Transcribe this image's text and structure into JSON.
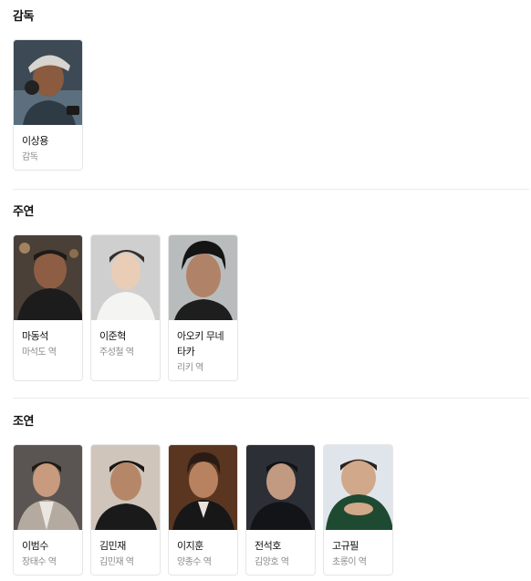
{
  "director_section": {
    "title": "감독",
    "people": [
      {
        "name": "이상용",
        "role": "감독"
      }
    ]
  },
  "main_section": {
    "title": "주연",
    "people": [
      {
        "name": "마동석",
        "role": "마석도 역"
      },
      {
        "name": "이준혁",
        "role": "주성철 역"
      },
      {
        "name": "아오키 무네타카",
        "role": "리키 역"
      }
    ]
  },
  "supporting_section": {
    "title": "조연",
    "people": [
      {
        "name": "이범수",
        "role": "장태수 역"
      },
      {
        "name": "김민재",
        "role": "김민재 역"
      },
      {
        "name": "이지훈",
        "role": "양종수 역"
      },
      {
        "name": "전석호",
        "role": "김양호 역"
      },
      {
        "name": "고규필",
        "role": "초롱이 역"
      }
    ]
  },
  "colors": {
    "divider": "#ececec",
    "card_border": "#e6e6e6",
    "role_text": "#8a8a8a"
  }
}
